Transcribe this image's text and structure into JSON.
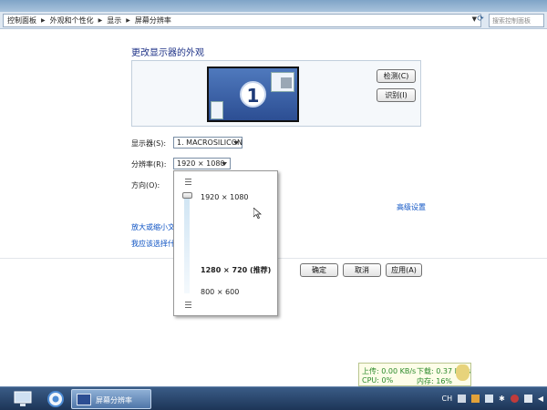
{
  "address_bar": {
    "crumbs": [
      "控制面板",
      "外观和个性化",
      "显示",
      "屏幕分辨率"
    ],
    "search_placeholder": "搜索控制面板"
  },
  "main": {
    "title": "更改显示器的外观",
    "monitor_number": "1",
    "detect_button": "检测(C)",
    "identify_button": "识别(I)",
    "display_label": "显示器(S):",
    "display_value": "1. MACROSILICON",
    "resolution_label": "分辨率(R):",
    "resolution_value": "1920 × 1080",
    "orientation_label": "方向(O):",
    "advanced_link": "高级设置",
    "link_text_size": "放大或缩小文本",
    "link_what": "我应该选择什么"
  },
  "resolution_dropdown": {
    "top_option": "1920 × 1080",
    "recommended_option": "1280 × 720 (推荐)",
    "bottom_option": "800 × 600"
  },
  "footer_buttons": {
    "ok": "确定",
    "cancel": "取消",
    "apply": "应用(A)"
  },
  "net_widget": {
    "upload": "上传: 0.00 KB/s",
    "download": "下载: 0.37 KB/s",
    "cpu": "CPU: 0%",
    "memory": "内存: 16%"
  },
  "taskbar": {
    "active_window": "屏幕分辨率",
    "tray_lang": "CH"
  }
}
